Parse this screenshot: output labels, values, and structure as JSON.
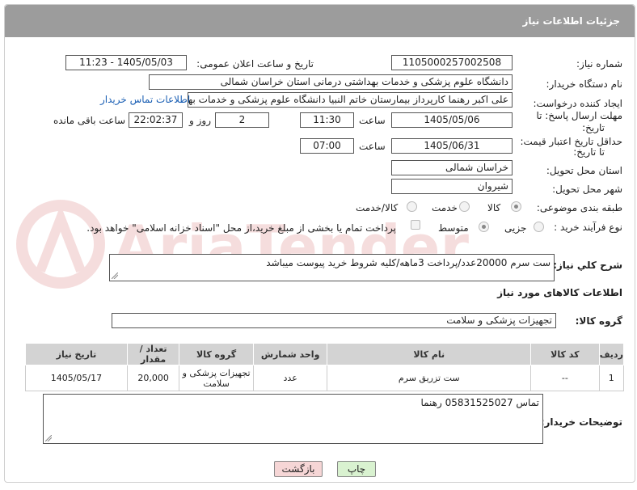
{
  "header": {
    "title": "جزئیات اطلاعات نیاز"
  },
  "fields": {
    "need_number_label": "شماره نیاز:",
    "need_number": "1105000257002508",
    "announce_label": "تاریخ و ساعت اعلان عمومی:",
    "announce_value": "1405/05/03 - 11:23",
    "buyer_org_label": "نام دستگاه خریدار:",
    "buyer_org": "دانشگاه علوم پزشکی و خدمات بهداشتی درمانی استان خراسان شمالی",
    "requester_label": "ایجاد کننده درخواست:",
    "requester": "علی اکبر رهنما کارپرداز بیمارستان خاتم النبیا دانشگاه علوم پزشکی و خدمات بهداشتی",
    "contact_link": "اطلاعات تماس خریدار",
    "reply_deadline_label_1": "مهلت ارسال پاسخ: تا",
    "reply_deadline_label_2": "تاریخ:",
    "reply_date": "1405/05/06",
    "time_label": "ساعت",
    "reply_time": "11:30",
    "days_value": "2",
    "days_label": "روز و",
    "remaining_value": "22:02:37",
    "remaining_label": "ساعت باقی مانده",
    "price_validity_label_1": "حداقل تاریخ اعتبار قیمت:",
    "price_validity_label_2": "تا تاریخ:",
    "price_date": "1405/06/31",
    "price_time_label": "ساعت",
    "price_time": "07:00",
    "province_label": "استان محل تحویل:",
    "province": "خراسان شمالی",
    "city_label": "شهر محل تحویل:",
    "city": "شیروان",
    "category_label": "طبقه بندی موضوعی:",
    "category_options": [
      "کالا",
      "خدمت",
      "کالا/خدمت"
    ],
    "process_label": "نوع فرآیند خرید :",
    "process_options": [
      "جزیی",
      "متوسط"
    ],
    "payment_note": "پرداخت تمام یا بخشی از مبلغ خرید،از محل \"اسناد خزانه اسلامی\" خواهد بود."
  },
  "description": {
    "label": "شرح کلي نياز:",
    "text": "ست سرم 20000عدد/پرداخت 3ماهه/کلیه شروط خرید پیوست میباشد"
  },
  "goods": {
    "section_title": "اطلاعات کالاهای مورد نیاز",
    "group_label": "گروه کالا:",
    "group_value": "تجهیزات پزشکی و سلامت",
    "columns": [
      "ردیف",
      "کد کالا",
      "نام کالا",
      "واحد شمارش",
      "گروه کالا",
      "تعداد / مقدار",
      "تاریخ نیاز"
    ],
    "rows": [
      [
        "1",
        "--",
        "ست تزریق سرم",
        "عدد",
        "تجهیزات پزشکی و سلامت",
        "20,000",
        "1405/05/17"
      ]
    ]
  },
  "buyer_notes": {
    "label": "توضیحات خریدار:",
    "text": "تماس 05831525027 رهنما"
  },
  "buttons": {
    "print": "چاپ",
    "back": "بازگشت"
  },
  "colors": {
    "header_bg": "#9c9c9c",
    "link": "#1a5fb4",
    "print_bg": "#d9f2d0",
    "back_bg": "#f6d6d6"
  },
  "watermark": "AriaTender.neT"
}
